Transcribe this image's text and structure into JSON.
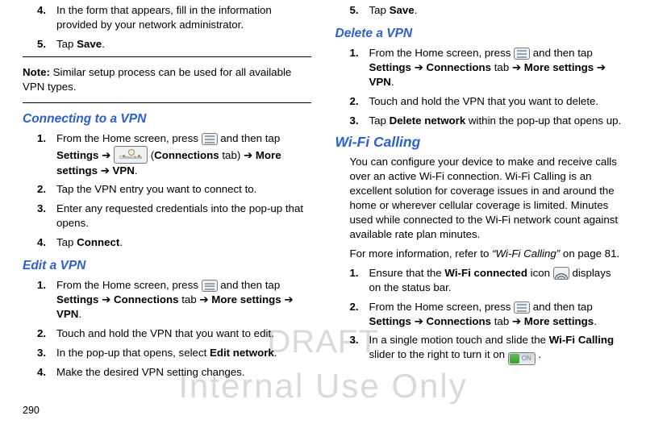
{
  "page_number": "290",
  "watermark_line1": "DRAFT",
  "watermark_line2": "Internal Use Only",
  "left": {
    "step4": {
      "num": "4.",
      "text_a": "In the form that appears, fill in the information provided by your network administrator."
    },
    "step5": {
      "num": "5.",
      "pre": "Tap ",
      "bold": "Save",
      "post": "."
    },
    "note_label": "Note:",
    "note_text": " Similar setup process can be used for all available VPN types.",
    "h_connect": "Connecting to a VPN",
    "c1": {
      "num": "1.",
      "a": "From the Home screen, press ",
      "b": " and then tap ",
      "bold1": "Settings",
      "arrow": " ➔ ",
      "conn_label": "Connections",
      "c": " (",
      "bold2": "Connections",
      "d": " tab) ",
      "bold3": "More settings",
      "bold4": "VPN"
    },
    "c2": {
      "num": "2.",
      "t": "Tap the VPN entry you want to connect to."
    },
    "c3": {
      "num": "3.",
      "t": "Enter any requested credentials into the pop-up that opens."
    },
    "c4": {
      "num": "4.",
      "pre": "Tap ",
      "bold": "Connect",
      "post": "."
    },
    "h_edit": "Edit a VPN",
    "e1": {
      "num": "1.",
      "a": "From the Home screen, press ",
      "b": " and then tap ",
      "bold1": "Settings",
      "bold2": "Connections",
      "tab": " tab ",
      "bold3": "More settings",
      "bold4": "VPN"
    },
    "e2": {
      "num": "2.",
      "t": "Touch and hold the VPN that you want to edit."
    },
    "e3": {
      "num": "3.",
      "a": "In the pop-up that opens, select ",
      "bold": "Edit network",
      "post": "."
    },
    "e4": {
      "num": "4.",
      "t": "Make the desired VPN setting changes."
    }
  },
  "right": {
    "r5": {
      "num": "5.",
      "pre": "Tap ",
      "bold": "Save",
      "post": "."
    },
    "h_delete": "Delete a VPN",
    "d1": {
      "num": "1.",
      "a": "From the Home screen, press ",
      "b": " and then tap ",
      "bold1": "Settings",
      "bold2": "Connections",
      "tab": " tab ",
      "bold3": "More settings",
      "bold4": "VPN"
    },
    "d2": {
      "num": "2.",
      "t": "Touch and hold the VPN that you want to delete."
    },
    "d3": {
      "num": "3.",
      "pre": "Tap ",
      "bold": "Delete network",
      "post": " within the pop-up that opens up."
    },
    "h_wifi": "Wi-Fi Calling",
    "wpara": "You can configure your device to make and receive calls over an active Wi-Fi connection. Wi-Fi Calling is an excellent solution for coverage issues in and around the home or wherever cellular coverage is limited. Minutes used while connected to the Wi-Fi network count against available rate plan minutes.",
    "wref_a": "For more information, refer to ",
    "wref_ital": "“Wi-Fi Calling” ",
    "wref_b": " on page 81.",
    "w1": {
      "num": "1.",
      "a": "Ensure that the ",
      "bold": "Wi-Fi connected",
      "b": " icon ",
      "c": " displays on the status bar."
    },
    "w2": {
      "num": "2.",
      "a": "From the Home screen, press ",
      "b": " and then tap ",
      "bold1": "Settings",
      "bold2": "Connections",
      "tab": " tab ",
      "bold3": "More settings"
    },
    "w3": {
      "num": "3.",
      "a": "In a single motion touch and slide the ",
      "bold": "Wi-Fi Calling",
      "b": " slider to the right to turn it on ",
      "toggle_label": "ON",
      "post": " ."
    }
  }
}
